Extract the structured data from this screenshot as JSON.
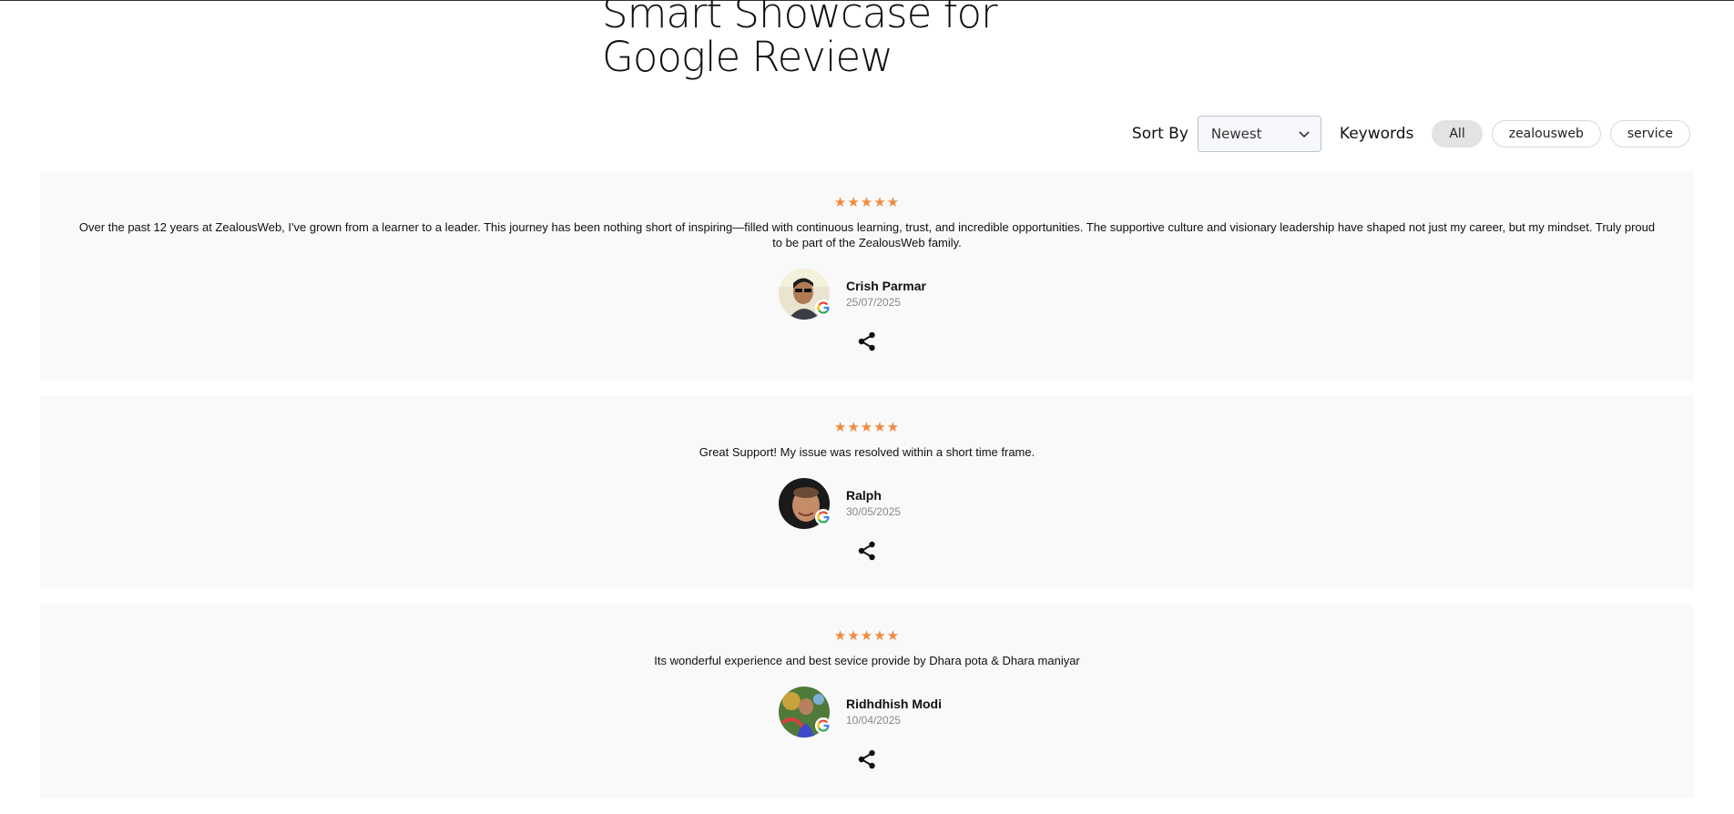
{
  "title": {
    "line1": "Smart Showcase for",
    "line2": "Google Review"
  },
  "controls": {
    "sort_label": "Sort By",
    "sort_value": "Newest",
    "keywords_label": "Keywords",
    "chips": [
      "All",
      "zealousweb",
      "service"
    ],
    "active_chip": "All"
  },
  "colors": {
    "star": "#f08a3e",
    "card_bg": "#f9f9f9",
    "chip_active": "#e3e3e3"
  },
  "reviews": [
    {
      "stars": "★★★★★",
      "text": "Over the past 12 years at ZealousWeb, I've grown from a learner to a leader. This journey has been nothing short of inspiring—filled with continuous learning, trust, and incredible opportunities. The supportive culture and visionary leadership have shaped not just my career, but my mindset. Truly proud to be part of the ZealousWeb family.",
      "name": "Crish Parmar",
      "date": "25/07/2025"
    },
    {
      "stars": "★★★★★",
      "text": "Great Support! My issue was resolved within a short time frame.",
      "name": "Ralph",
      "date": "30/05/2025"
    },
    {
      "stars": "★★★★★",
      "text": "Its wonderful experience and best sevice provide by Dhara pota & Dhara maniyar",
      "name": "Ridhdhish Modi",
      "date": "10/04/2025"
    }
  ]
}
